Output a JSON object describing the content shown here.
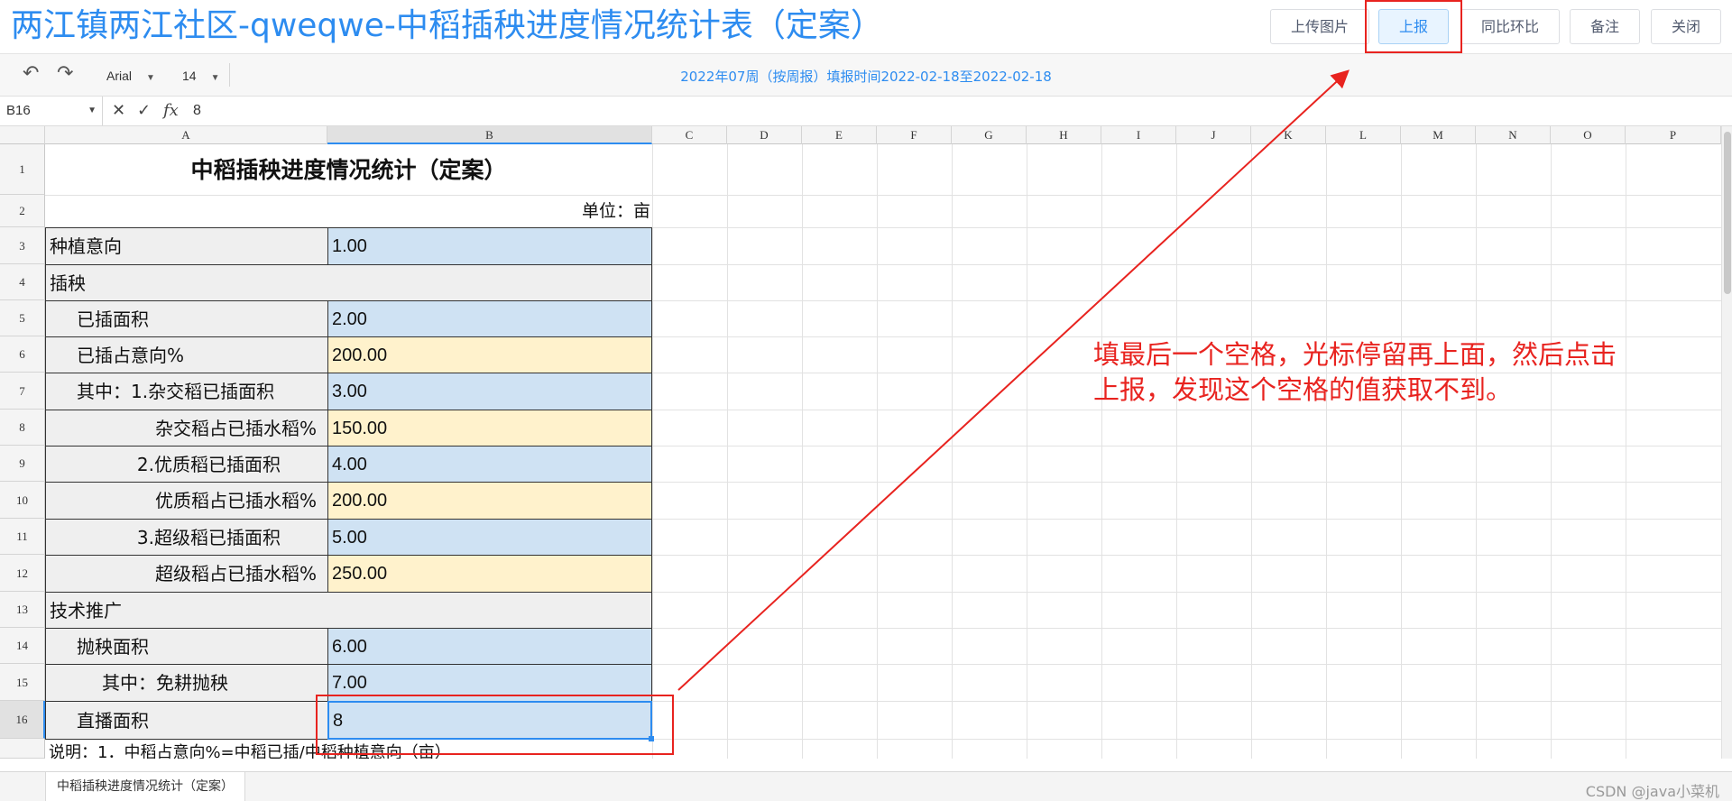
{
  "window": {
    "title": "两江镇两江社区-qweqwe-中稻插秧进度情况统计表（定案）"
  },
  "top_buttons": {
    "upload_image": "上传图片",
    "report": "上报",
    "compare": "同比环比",
    "remark": "备注",
    "close": "关闭"
  },
  "toolbar": {
    "undo_icon": "undo-icon",
    "redo_icon": "redo-icon",
    "font_family": "Arial",
    "font_size": "14",
    "week_info": "2022年07周（按周报）填报时间2022-02-18至2022-02-18"
  },
  "formula_bar": {
    "cell_ref": "B16",
    "value": "8",
    "fx_label": "fx"
  },
  "grid": {
    "columns": [
      "A",
      "B",
      "C",
      "D",
      "E",
      "F",
      "G",
      "H",
      "I",
      "J",
      "K",
      "L",
      "M",
      "N",
      "O",
      "P"
    ],
    "rows": [
      "1",
      "2",
      "3",
      "4",
      "5",
      "6",
      "7",
      "8",
      "9",
      "10",
      "11",
      "12",
      "13",
      "14",
      "15",
      "16"
    ],
    "active_column": "B",
    "active_row": "16"
  },
  "sheet": {
    "title": "中稻插秧进度情况统计（定案）",
    "unit": "单位：亩",
    "rows": [
      {
        "label": "种植意向",
        "value": "1.00",
        "fill": "blue"
      },
      {
        "label": "插秧",
        "value": "",
        "fill": "section"
      },
      {
        "label": "已插面积",
        "value": "2.00",
        "fill": "blue"
      },
      {
        "label": "已插占意向%",
        "value": "200.00",
        "fill": "yellow"
      },
      {
        "label": "其中：1.杂交稻已插面积",
        "value": "3.00",
        "fill": "blue"
      },
      {
        "label": "杂交稻占已插水稻%",
        "value": "150.00",
        "fill": "yellow"
      },
      {
        "label": "2.优质稻已插面积",
        "value": "4.00",
        "fill": "blue"
      },
      {
        "label": "优质稻占已插水稻%",
        "value": "200.00",
        "fill": "yellow"
      },
      {
        "label": "3.超级稻已插面积",
        "value": "5.00",
        "fill": "blue"
      },
      {
        "label": "超级稻占已插水稻%",
        "value": "250.00",
        "fill": "yellow"
      },
      {
        "label": "技术推广",
        "value": "",
        "fill": "section"
      },
      {
        "label": "抛秧面积",
        "value": "6.00",
        "fill": "blue"
      },
      {
        "label": "其中：免耕抛秧",
        "value": "7.00",
        "fill": "blue"
      },
      {
        "label": "直播面积",
        "value": "8",
        "fill": "selected"
      }
    ],
    "note": "说明：1．中稻占意向%=中稻已插/中稻种植意向（亩）"
  },
  "sheet_tabs": [
    "中稻插秧进度情况统计（定案）"
  ],
  "watermark": "CSDN @java小菜机",
  "annotation": {
    "text_line1": "填最后一个空格，光标停留再上面，然后点击",
    "text_line2": "上报，发现这个空格的值获取不到。",
    "color": "#e8231f"
  },
  "colors": {
    "accent": "#2d8cf0",
    "input_blue": "#cfe2f3",
    "computed_yellow": "#fff2cc",
    "label_gray": "#efefef"
  }
}
